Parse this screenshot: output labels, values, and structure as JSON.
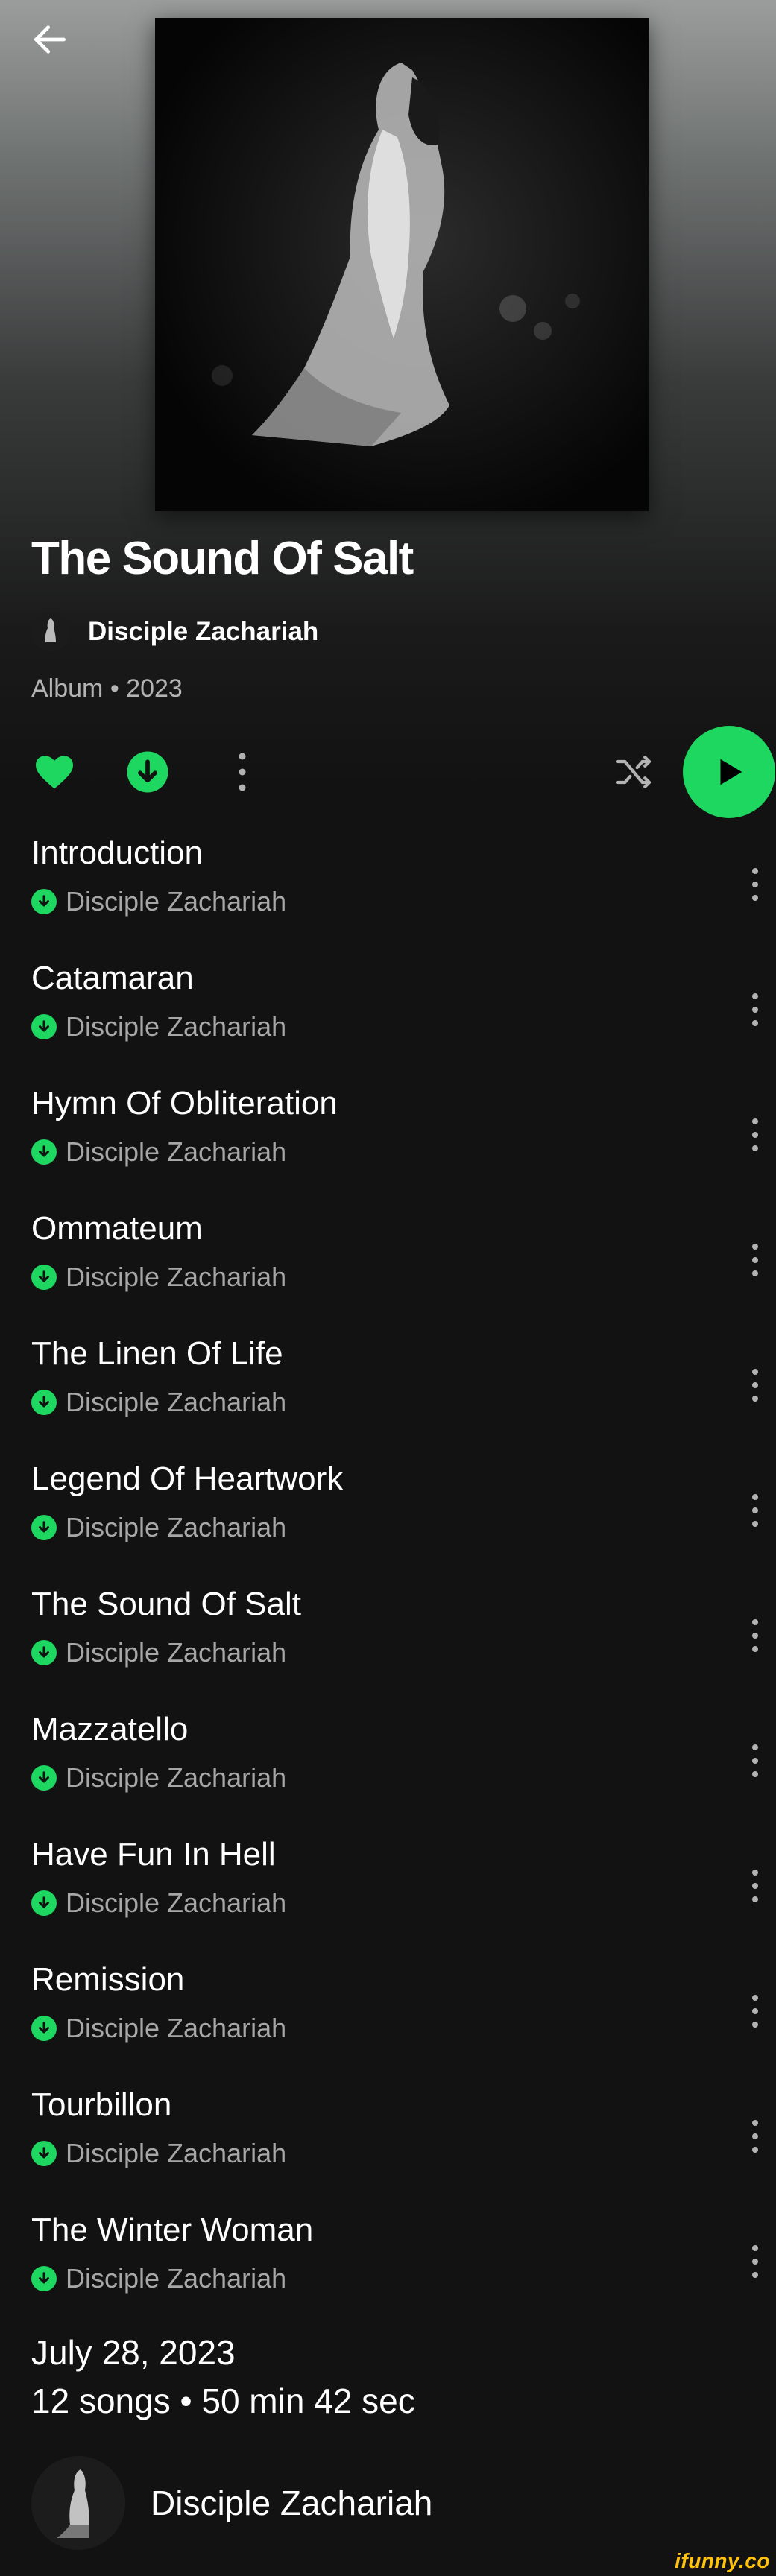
{
  "album": {
    "title": "The Sound Of Salt",
    "artist": "Disciple Zachariah",
    "meta": "Album • 2023",
    "release_date": "July 28, 2023",
    "summary": "12 songs • 50 min 42 sec"
  },
  "icons": {
    "back": "arrow-left-icon",
    "like": "heart-icon",
    "download": "download-icon",
    "more": "more-vertical-icon",
    "shuffle": "shuffle-icon",
    "play": "play-icon"
  },
  "colors": {
    "accent": "#1ed760",
    "background": "#121212",
    "secondary_text": "#a7a7a7",
    "watermark": "#ffc20e"
  },
  "tracks": [
    {
      "title": "Introduction",
      "artist": "Disciple Zachariah"
    },
    {
      "title": "Catamaran",
      "artist": "Disciple Zachariah"
    },
    {
      "title": "Hymn Of Obliteration",
      "artist": "Disciple Zachariah"
    },
    {
      "title": "Ommateum",
      "artist": "Disciple Zachariah"
    },
    {
      "title": "The Linen Of Life",
      "artist": "Disciple Zachariah"
    },
    {
      "title": "Legend Of Heartwork",
      "artist": "Disciple Zachariah"
    },
    {
      "title": "The Sound Of Salt",
      "artist": "Disciple Zachariah"
    },
    {
      "title": "Mazzatello",
      "artist": "Disciple Zachariah"
    },
    {
      "title": "Have Fun In Hell",
      "artist": "Disciple Zachariah"
    },
    {
      "title": "Remission",
      "artist": "Disciple Zachariah"
    },
    {
      "title": "Tourbillon",
      "artist": "Disciple Zachariah"
    },
    {
      "title": "The Winter Woman",
      "artist": "Disciple Zachariah"
    }
  ],
  "footer": {
    "artist_name": "Disciple Zachariah"
  },
  "watermark": "ifunny.co"
}
